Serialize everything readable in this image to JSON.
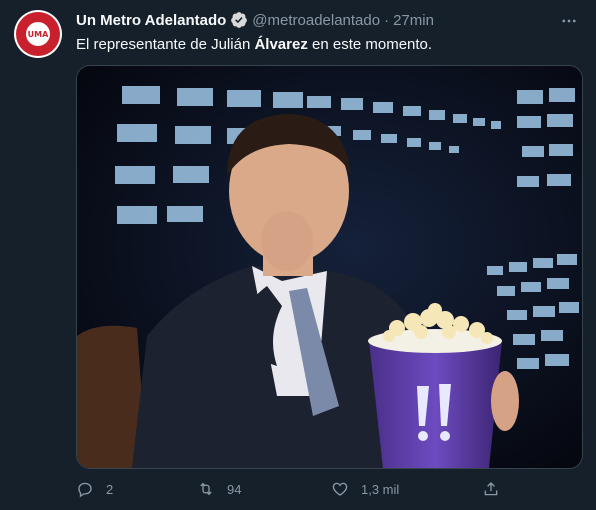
{
  "tweet": {
    "author_name": "Un Metro Adelantado",
    "handle": "@metroadelantado",
    "separator": "·",
    "time": "27min",
    "text_before": "El representante de Julián ",
    "text_bold": "Álvarez",
    "text_after": " en este momento.",
    "avatar_text": "UMA"
  },
  "actions": {
    "replies": "2",
    "retweets": "94",
    "likes": "1,3 mil"
  },
  "icons": {
    "verified": "verified-badge-icon",
    "more": "more-options-icon",
    "reply": "reply-icon",
    "retweet": "retweet-icon",
    "like": "heart-icon",
    "share": "share-icon"
  },
  "colors": {
    "background": "#15202b",
    "muted": "#8b98a5",
    "brand_red": "#c8202c"
  }
}
